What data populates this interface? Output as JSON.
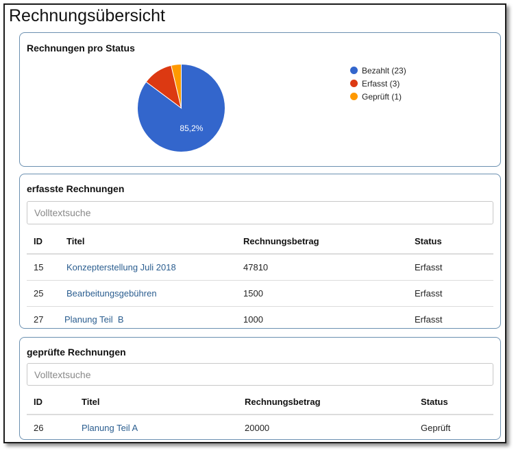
{
  "page": {
    "title": "Rechnungsübersicht"
  },
  "chart_panel": {
    "title": "Rechnungen pro Status"
  },
  "chart_data": {
    "type": "pie",
    "title": "Rechnungen pro Status",
    "slices": [
      {
        "label": "Bezahlt (23)",
        "value": 23,
        "color": "#3366cc"
      },
      {
        "label": "Erfasst (3)",
        "value": 3,
        "color": "#dc3912"
      },
      {
        "label": "Geprüft (1)",
        "value": 1,
        "color": "#ff9900"
      }
    ],
    "slice_labels": [
      "85,2%"
    ],
    "legend_position": "right"
  },
  "erfasst_panel": {
    "title": "erfasste Rechnungen",
    "search_placeholder": "Volltextsuche",
    "columns": [
      "ID",
      "Titel",
      "Rechnungsbetrag",
      "Status"
    ],
    "rows": [
      {
        "id": "15",
        "titel": "Konzepterstellung Juli 2018",
        "betrag": "47810",
        "status": "Erfasst"
      },
      {
        "id": "25",
        "titel": "Bearbeitungsgebühren",
        "betrag": "1500",
        "status": "Erfasst"
      },
      {
        "id": "27",
        "titel": "Planung Teil  B",
        "betrag": "1000",
        "status": "Erfasst"
      }
    ]
  },
  "geprueft_panel": {
    "title": "geprüfte Rechnungen",
    "search_placeholder": "Volltextsuche",
    "columns": [
      "ID",
      "Titel",
      "Rechnungsbetrag",
      "Status"
    ],
    "rows": [
      {
        "id": "26",
        "titel": "Planung Teil A",
        "betrag": "20000",
        "status": "Geprüft"
      }
    ]
  }
}
